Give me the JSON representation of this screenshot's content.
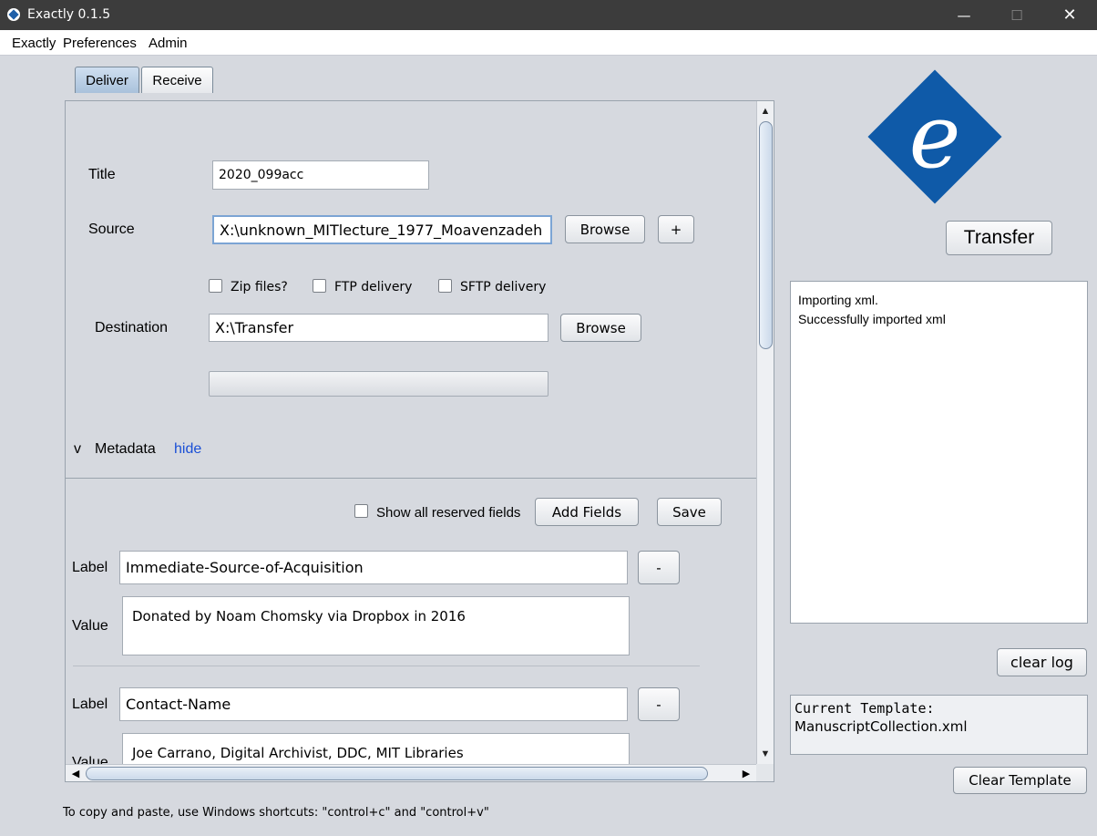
{
  "window": {
    "title": "Exactly 0.1.5",
    "minimize": "—",
    "maximize": "☐",
    "close": "✕"
  },
  "menu": [
    "Exactly",
    "Preferences",
    "Admin"
  ],
  "tabs": [
    {
      "label": "Deliver",
      "active": true
    },
    {
      "label": "Receive",
      "active": false
    }
  ],
  "form": {
    "title_label": "Title",
    "title_value": "2020_099acc",
    "source_label": "Source",
    "source_value": "X:\\unknown_MITlecture_1977_Moavenzadeh",
    "browse_label": "Browse",
    "add_label": "+",
    "zip_label": "Zip files?",
    "ftp_label": "FTP delivery",
    "sftp_label": "SFTP delivery",
    "destination_label": "Destination",
    "destination_value": "X:\\Transfer",
    "progress": 0
  },
  "metadata": {
    "toggle": "v",
    "heading": "Metadata",
    "hide_link": "hide",
    "show_reserved_label": "Show all reserved fields",
    "add_fields_label": "Add Fields",
    "save_label": "Save",
    "label_caption": "Label",
    "value_caption": "Value",
    "remove_label": "-",
    "fields": [
      {
        "label": "Immediate-Source-of-Acquisition",
        "value": "Donated by Noam Chomsky via Dropbox in 2016"
      },
      {
        "label": "Contact-Name",
        "value": "Joe Carrano, Digital Archivist, DDC, MIT Libraries"
      }
    ]
  },
  "right": {
    "logo_letter": "e",
    "transfer_label": "Transfer",
    "log_lines": [
      "Importing xml.",
      "Successfully imported xml"
    ],
    "clear_log_label": "clear log",
    "template_caption": "Current Template:",
    "template_name": "ManuscriptCollection.xml",
    "clear_template_label": "Clear Template"
  },
  "footer": "To copy and paste, use Windows shortcuts: \"control+c\" and \"control+v\"",
  "colors": {
    "accent": "#0f5aa8",
    "link": "#1a4fd6",
    "background": "#d6d9df"
  }
}
